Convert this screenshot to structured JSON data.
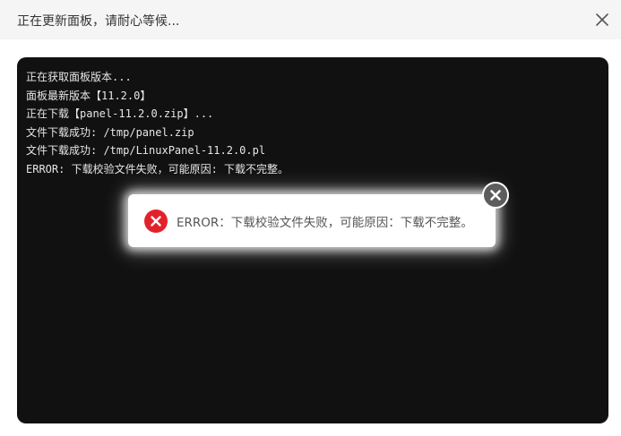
{
  "dialog": {
    "title": "正在更新面板，请耐心等候...",
    "close_icon": "close-icon"
  },
  "terminal": {
    "lines": [
      "正在获取面板版本...",
      "面板最新版本【11.2.0】",
      "正在下载【panel-11.2.0.zip】...",
      "文件下载成功: /tmp/panel.zip",
      "文件下载成功: /tmp/LinuxPanel-11.2.0.pl",
      "ERROR: 下载校验文件失败，可能原因: 下载不完整。"
    ]
  },
  "toast": {
    "message": "ERROR：下载校验文件失败，可能原因：下载不完整。",
    "icon": "error-icon",
    "close_icon": "close-circle-icon",
    "error_color": "#e2222b"
  }
}
